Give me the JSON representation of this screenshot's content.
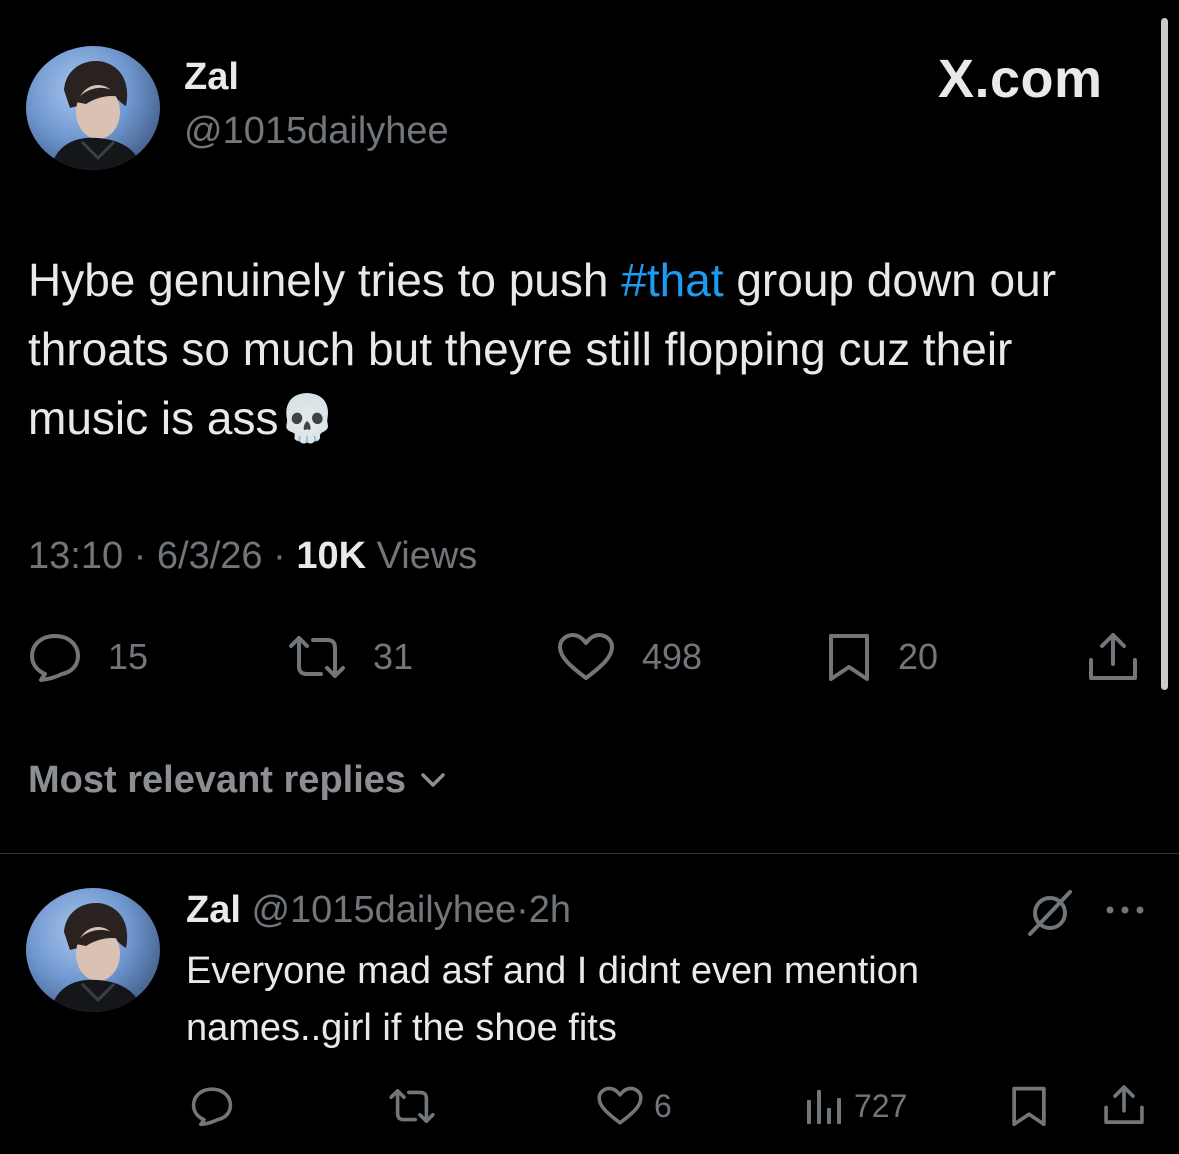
{
  "tweet": {
    "author": {
      "name": "Zal",
      "handle": "@1015dailyhee"
    },
    "brand": "X.com",
    "text_before": "Hybe genuinely tries to push ",
    "hashtag": "#that",
    "text_after": " group down our throats so much but theyre still flopping cuz their music is ass",
    "emoji": "💀",
    "time": "13:10",
    "date": "6/3/26",
    "views_count": "10K",
    "views_label": "Views",
    "separator": "·",
    "stats": {
      "replies": "15",
      "reposts": "31",
      "likes": "498",
      "bookmarks": "20"
    }
  },
  "replies_header": {
    "label": "Most relevant replies"
  },
  "reply": {
    "author": {
      "name": "Zal",
      "handle": "@1015dailyhee"
    },
    "separator": "·",
    "time": "2h",
    "text": "Everyone mad asf and I didnt even mention names..girl if the shoe fits",
    "stats": {
      "likes": "6",
      "views": "727"
    }
  },
  "icons": {
    "reply": "speech-bubble-icon",
    "repost": "repost-arrows-icon",
    "like": "heart-icon",
    "bookmark": "bookmark-icon",
    "share": "share-upload-icon",
    "views": "bar-chart-icon",
    "grok": "grok-slash-icon",
    "more": "more-dots-icon",
    "chevron": "chevron-down-icon"
  },
  "colors": {
    "background": "#000000",
    "text": "#e7e9ea",
    "muted": "#71767b",
    "link": "#1d9bf0",
    "divider": "#2f3336"
  }
}
